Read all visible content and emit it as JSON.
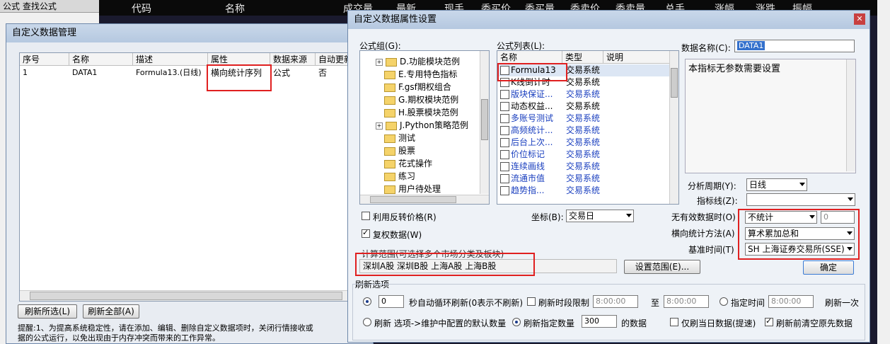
{
  "bg_app": {
    "left_title": "公式  查找公式",
    "market_columns": [
      "代码",
      "名称",
      "成交量",
      "最新",
      "现手",
      "委买价",
      "委买量",
      "委卖价",
      "委卖量",
      "总手",
      "涨幅",
      "涨跌",
      "振幅"
    ]
  },
  "win_manage": {
    "title": "自定义数据管理",
    "columns": [
      "序号",
      "名称",
      "描述",
      "属性",
      "数据来源",
      "自动更新"
    ],
    "rows": [
      {
        "index": "1",
        "name": "DATA1",
        "desc": "Formula13.(日线)",
        "attr": "横向统计序列",
        "source": "公式",
        "auto": "否"
      }
    ],
    "btn_refresh_selected": "刷新所选(L)",
    "btn_refresh_all": "刷新全部(A)",
    "tip_line1": "提醒:1、为提高系统稳定性，请在添加、编辑、删除自定义数据项时，关闭行情接收或",
    "tip_line2": "据的公式运行，以免出现由于内存冲突而带来的工作异常。"
  },
  "win_prop": {
    "title": "自定义数据属性设置",
    "group_label": "公式组(G):",
    "tree": [
      {
        "label": "D.功能模块范例",
        "expand": true
      },
      {
        "label": "E.专用特色指标",
        "expand": false
      },
      {
        "label": "F.gsf期权组合",
        "expand": false
      },
      {
        "label": "G.期权模块范例",
        "expand": false
      },
      {
        "label": "H.股票模块范例",
        "expand": false
      },
      {
        "label": "J.Python策略范例",
        "expand": true
      },
      {
        "label": "测试",
        "expand": false
      },
      {
        "label": "股票",
        "expand": false
      },
      {
        "label": "花式操作",
        "expand": false
      },
      {
        "label": "练习",
        "expand": false
      },
      {
        "label": "用户待处理",
        "expand": false
      }
    ],
    "list_label": "公式列表(L):",
    "list_cols": [
      "名称",
      "类型",
      "说明"
    ],
    "list_rows": [
      {
        "name": "Formula13",
        "type": "交易系统",
        "blue": false
      },
      {
        "name": "K线倒计时",
        "type": "交易系统",
        "blue": false
      },
      {
        "name": "版块保证...",
        "type": "交易系统",
        "blue": true
      },
      {
        "name": "动态权益...",
        "type": "交易系统",
        "blue": false
      },
      {
        "name": "多账号测试",
        "type": "交易系统",
        "blue": true
      },
      {
        "name": "高频统计...",
        "type": "交易系统",
        "blue": true
      },
      {
        "name": "后台上次...",
        "type": "交易系统",
        "blue": true
      },
      {
        "name": "价位标记",
        "type": "交易系统",
        "blue": true
      },
      {
        "name": "连续画线",
        "type": "交易系统",
        "blue": true
      },
      {
        "name": "流通市值",
        "type": "交易系统",
        "blue": true
      },
      {
        "name": "趋势指...",
        "type": "交易系统",
        "blue": true
      }
    ],
    "data_name_label": "数据名称(C):",
    "data_name_value": "DATA1",
    "param_text": "本指标无参数需要设置",
    "period_label": "分析周期(Y):",
    "period_value": "日线",
    "indicator_label": "指标线(Z):",
    "indicator_value": "",
    "reverse_price": "利用反转价格(R)",
    "restore": "复权数据(W)",
    "axis_label": "坐标(B):",
    "axis_value": "交易日",
    "invalid_label": "无有效数据时(O)",
    "invalid_value": "不统计",
    "invalid_num": "0",
    "stat_label": "横向统计方法(A)",
    "stat_value": "算术累加总和",
    "base_label": "基准时间(T)",
    "base_value": "SH 上海证券交易所(SSE)",
    "range_label": "计算范围(可选择多个市场分类及板块)",
    "range_value": "深圳A股  深圳B股  上海A股  上海B股",
    "btn_set_range": "设置范围(E)...",
    "btn_ok": "确定",
    "refresh_section": "刷新选项",
    "auto_refresh_sec": "0",
    "auto_refresh_text": "秒自动循环刷新(0表示不刷新)",
    "period_limit": "刷新时段限制",
    "time_start": "8:00:00",
    "to": "至",
    "time_end": "8:00:00",
    "fixed_time": "指定时间",
    "fixed_time_val": "8:00:00",
    "refresh_once": "刷新一次",
    "refresh_cfg": "刷新 选项->维护中配置的默认数量",
    "refresh_count_label": "刷新指定数量",
    "refresh_count": "300",
    "refresh_count_unit": "的数据",
    "today_only": "仅刷当日数据(提速)",
    "clear_before": "刷新前清空原先数据"
  },
  "colors": {
    "highlight_red": "#e02020",
    "selected_blue": "#3370cc"
  }
}
